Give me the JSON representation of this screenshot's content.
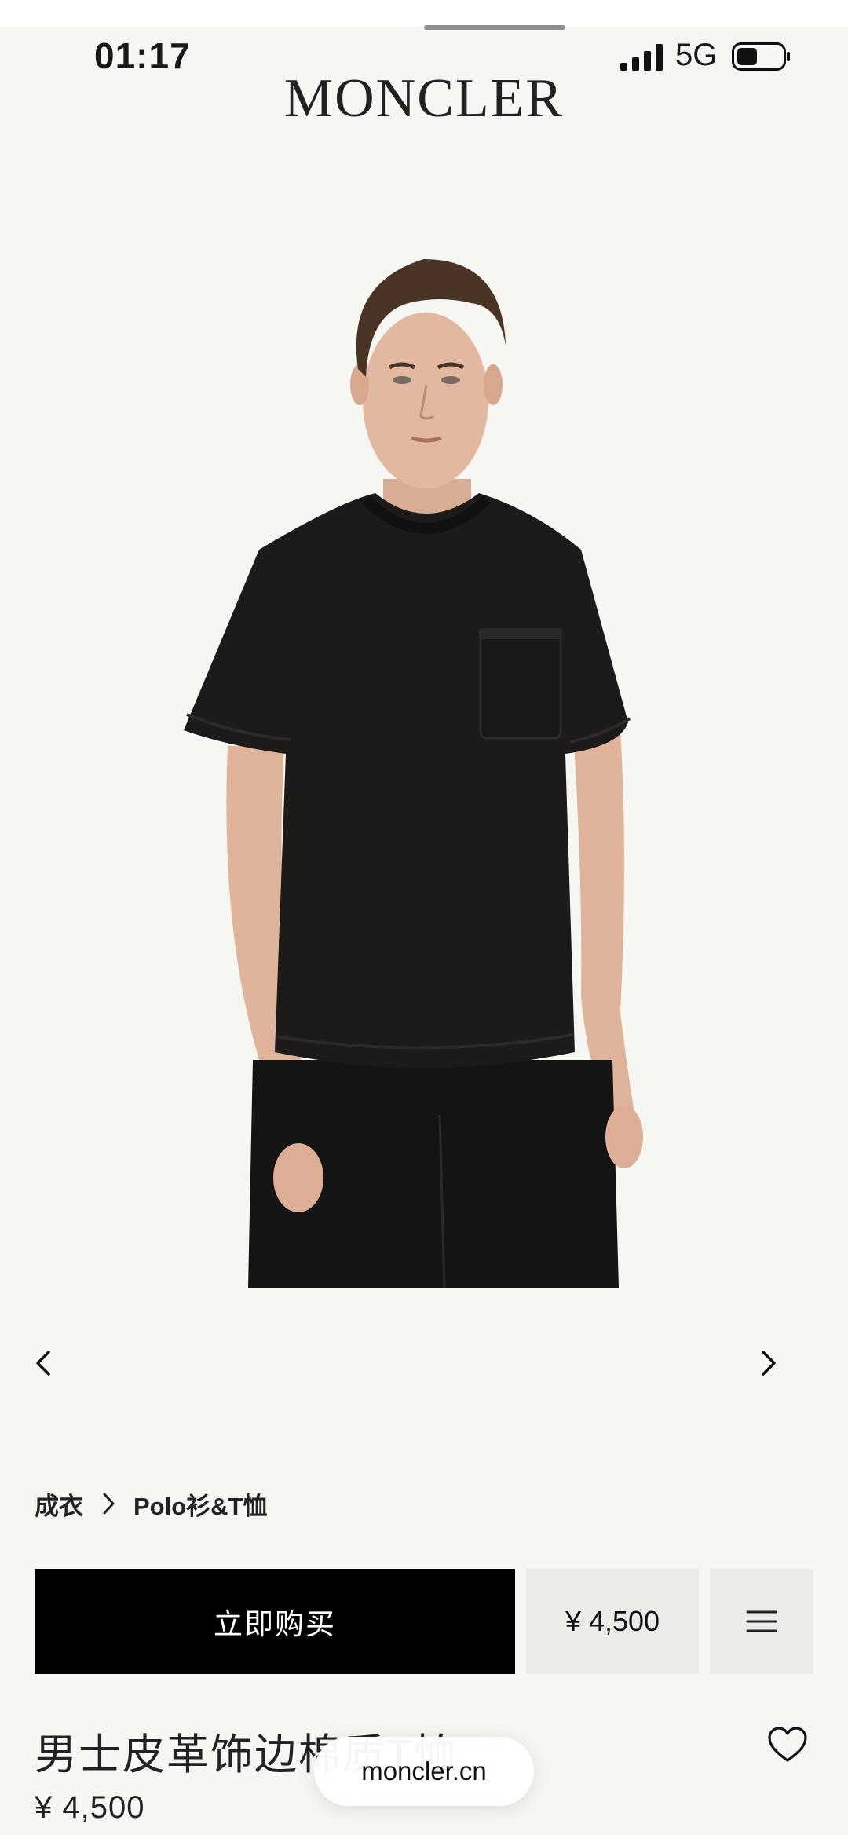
{
  "status_bar": {
    "time": "01:17",
    "network": "5G",
    "battery_level": 0.45
  },
  "header": {
    "brand": "MONCLER"
  },
  "gallery": {
    "prev_icon": "chevron-left-icon",
    "next_icon": "chevron-right-icon",
    "image_subject": "model wearing black short-sleeve t-shirt with leather-trimmed chest pocket"
  },
  "breadcrumb": {
    "items": [
      "成衣",
      "Polo衫&T恤"
    ]
  },
  "actions": {
    "buy_label": "立即购买",
    "price_label": "¥ 4,500",
    "menu_icon": "menu-icon"
  },
  "product": {
    "title": "男士皮革饰边棉质T恤",
    "price": "¥ 4,500",
    "wishlist_icon": "heart-icon"
  },
  "browser": {
    "url": "moncler.cn"
  },
  "colors": {
    "background": "#f6f6f3",
    "button_black": "#000000",
    "secondary_button": "#ebebe8"
  }
}
